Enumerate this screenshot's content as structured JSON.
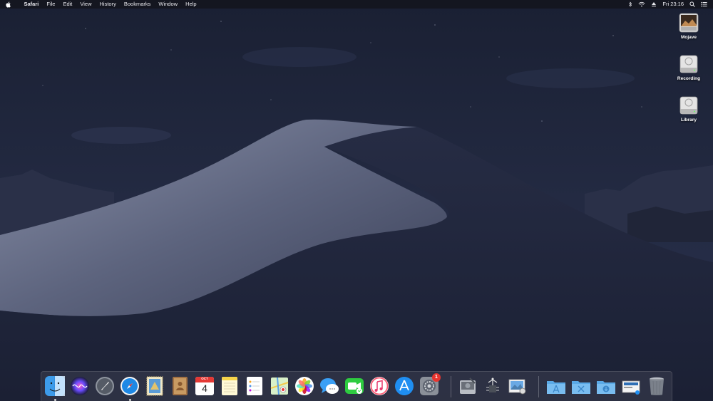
{
  "menubar": {
    "app_name": "Safari",
    "menus": [
      "File",
      "Edit",
      "View",
      "History",
      "Bookmarks",
      "Window",
      "Help"
    ],
    "clock": "Fri 23:16"
  },
  "desktop": {
    "icons": [
      {
        "label": "Mojave"
      },
      {
        "label": "Recording"
      },
      {
        "label": "Library"
      }
    ]
  },
  "dock": {
    "apps": [
      {
        "name": "Finder",
        "running": true
      },
      {
        "name": "Siri",
        "running": false
      },
      {
        "name": "Launchpad",
        "running": false
      },
      {
        "name": "Safari",
        "running": true
      },
      {
        "name": "Mail",
        "running": false
      },
      {
        "name": "Contacts",
        "running": false
      },
      {
        "name": "Calendar",
        "running": false
      },
      {
        "name": "Notes",
        "running": false
      },
      {
        "name": "Reminders",
        "running": false
      },
      {
        "name": "Maps",
        "running": false
      },
      {
        "name": "Photos",
        "running": false
      },
      {
        "name": "Messages",
        "running": false
      },
      {
        "name": "FaceTime",
        "running": false
      },
      {
        "name": "iTunes",
        "running": false
      },
      {
        "name": "App Store",
        "running": false
      },
      {
        "name": "System Preferences",
        "running": false
      },
      {
        "name": "Disk Utility",
        "running": false
      },
      {
        "name": "System Information",
        "running": false
      },
      {
        "name": "Preview",
        "running": false
      },
      {
        "name": "Applications",
        "running": false
      },
      {
        "name": "Utilities",
        "running": false
      },
      {
        "name": "Downloads",
        "running": false
      },
      {
        "name": "Image",
        "running": false
      },
      {
        "name": "Trash",
        "running": false
      }
    ],
    "calendar": {
      "month": "OCT",
      "day": "4"
    },
    "system_preferences_badge": "1"
  },
  "colors": {
    "sky": "#1b2236",
    "dune_light": "#6f7690",
    "dune_dark": "#1f2438",
    "menubar": "#14161e",
    "badge": "#e8352f"
  }
}
